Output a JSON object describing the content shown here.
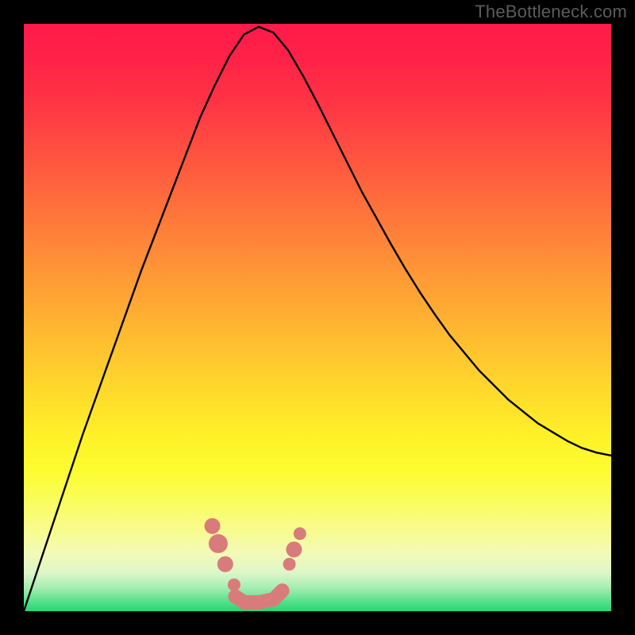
{
  "watermark": "TheBottleneck.com",
  "gradient": {
    "stops": [
      {
        "offset": 0.0,
        "color": "#ff1a4a"
      },
      {
        "offset": 0.06,
        "color": "#ff2247"
      },
      {
        "offset": 0.14,
        "color": "#ff3644"
      },
      {
        "offset": 0.22,
        "color": "#ff5140"
      },
      {
        "offset": 0.3,
        "color": "#ff6d3c"
      },
      {
        "offset": 0.38,
        "color": "#ff8838"
      },
      {
        "offset": 0.46,
        "color": "#ffa334"
      },
      {
        "offset": 0.54,
        "color": "#ffbe30"
      },
      {
        "offset": 0.62,
        "color": "#ffd82c"
      },
      {
        "offset": 0.7,
        "color": "#fff028"
      },
      {
        "offset": 0.76,
        "color": "#fcfd30"
      },
      {
        "offset": 0.81,
        "color": "#fafd5a"
      },
      {
        "offset": 0.86,
        "color": "#f8fc8c"
      },
      {
        "offset": 0.9,
        "color": "#f3fab6"
      },
      {
        "offset": 0.935,
        "color": "#dcf6c8"
      },
      {
        "offset": 0.96,
        "color": "#a7edb2"
      },
      {
        "offset": 0.98,
        "color": "#63e291"
      },
      {
        "offset": 1.0,
        "color": "#1fd873"
      }
    ]
  },
  "markers": {
    "color": "#d97b7b",
    "radius_large": 12,
    "radius_med": 10,
    "radius_small": 8,
    "points": [
      {
        "x_norm": 0.321,
        "y_norm": 0.855,
        "r": "med"
      },
      {
        "x_norm": 0.331,
        "y_norm": 0.885,
        "r": "large"
      },
      {
        "x_norm": 0.343,
        "y_norm": 0.92,
        "r": "med"
      },
      {
        "x_norm": 0.358,
        "y_norm": 0.955,
        "r": "small"
      },
      {
        "x_norm": 0.452,
        "y_norm": 0.92,
        "r": "small"
      },
      {
        "x_norm": 0.46,
        "y_norm": 0.895,
        "r": "med"
      },
      {
        "x_norm": 0.47,
        "y_norm": 0.868,
        "r": "small"
      }
    ],
    "floor_path": [
      {
        "x_norm": 0.36,
        "y_norm": 0.975
      },
      {
        "x_norm": 0.375,
        "y_norm": 0.985
      },
      {
        "x_norm": 0.4,
        "y_norm": 0.985
      },
      {
        "x_norm": 0.425,
        "y_norm": 0.98
      },
      {
        "x_norm": 0.44,
        "y_norm": 0.965
      }
    ]
  },
  "chart_data": {
    "type": "line",
    "title": "",
    "xlabel": "",
    "ylabel": "",
    "xlim": [
      0,
      1
    ],
    "ylim": [
      0,
      1
    ],
    "x": [
      0.0,
      0.025,
      0.05,
      0.075,
      0.1,
      0.125,
      0.15,
      0.175,
      0.2,
      0.225,
      0.25,
      0.275,
      0.3,
      0.325,
      0.35,
      0.375,
      0.4,
      0.425,
      0.45,
      0.475,
      0.5,
      0.525,
      0.55,
      0.575,
      0.6,
      0.625,
      0.65,
      0.675,
      0.7,
      0.725,
      0.75,
      0.775,
      0.8,
      0.825,
      0.85,
      0.875,
      0.9,
      0.925,
      0.95,
      0.975,
      1.0
    ],
    "series": [
      {
        "name": "bottleneck-curve",
        "values": [
          1.0,
          0.925,
          0.85,
          0.775,
          0.7,
          0.63,
          0.56,
          0.49,
          0.42,
          0.355,
          0.29,
          0.225,
          0.16,
          0.105,
          0.055,
          0.018,
          0.005,
          0.015,
          0.045,
          0.088,
          0.135,
          0.185,
          0.235,
          0.285,
          0.33,
          0.375,
          0.418,
          0.458,
          0.495,
          0.53,
          0.56,
          0.59,
          0.615,
          0.64,
          0.66,
          0.68,
          0.695,
          0.71,
          0.722,
          0.73,
          0.735
        ]
      }
    ],
    "note": "y is plotted downward-increasing in pixel space; values here are given as y_norm where 0=top of plot, 1=bottom (green floor). The curve descends from top-left, bottoms out near x≈0.40, and rises toward the right at ~73% height."
  }
}
